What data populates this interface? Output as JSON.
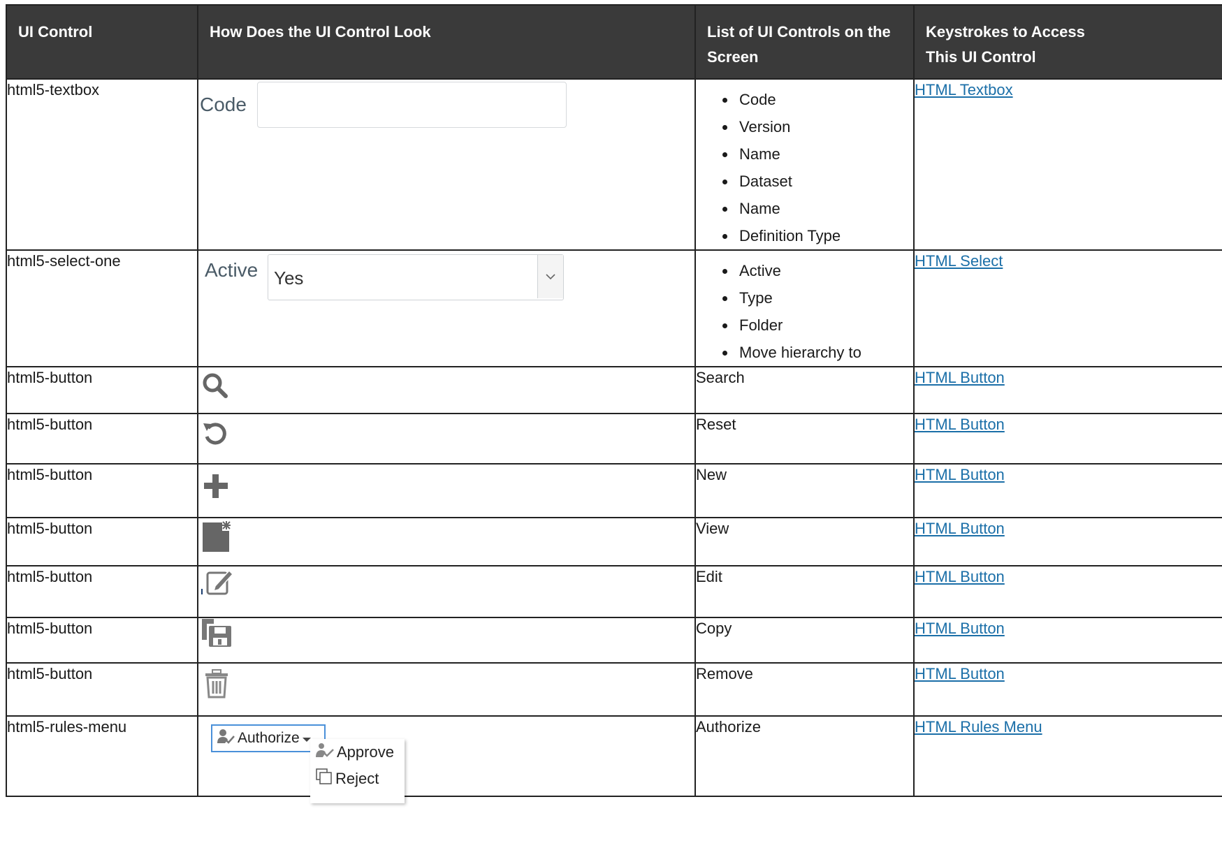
{
  "table": {
    "headers": {
      "ui_control": "UI Control",
      "look": "How Does the UI Control Look",
      "list_line1": "List of UI Controls on the",
      "list_line2": "Screen",
      "keys_line1": "Keystrokes to Access",
      "keys_line2": "This UI Control"
    },
    "rows": [
      {
        "control": "html5-textbox",
        "items": [
          "Code",
          "Version",
          "Name",
          "Dataset",
          "Name",
          "Definition Type"
        ],
        "link": "HTML Textbox"
      },
      {
        "control": "html5-select-one",
        "items": [
          "Active",
          "Type",
          "Folder",
          "Move hierarchy to"
        ],
        "link": "HTML Select"
      },
      {
        "control": "html5-button",
        "list_text": "Search",
        "link": "HTML Button"
      },
      {
        "control": "html5-button",
        "list_text": "Reset",
        "link": "HTML Button"
      },
      {
        "control": "html5-button",
        "list_text": "New",
        "link": "HTML Button"
      },
      {
        "control": "html5-button",
        "list_text": "View",
        "link": "HTML Button"
      },
      {
        "control": "html5-button",
        "list_text": "Edit",
        "link": "HTML Button"
      },
      {
        "control": "html5-button",
        "list_text": "Copy",
        "link": "HTML Button"
      },
      {
        "control": "html5-button",
        "list_text": "Remove",
        "link": "HTML Button"
      },
      {
        "control": "html5-rules-menu",
        "list_text": "Authorize",
        "link": "HTML Rules Menu"
      }
    ]
  },
  "samples": {
    "textbox_label": "Code",
    "select_label": "Active",
    "select_value": "Yes",
    "menu_label": "Authorize",
    "menu_items": [
      "Approve",
      "Reject"
    ]
  },
  "icons": [
    "search-icon",
    "reset-icon",
    "add-icon",
    "view-icon",
    "edit-icon",
    "copy-icon",
    "delete-icon",
    "authorize-icon",
    "approve-icon",
    "reject-icon",
    "chevron-down-icon"
  ],
  "colors": {
    "header_bg": "#3a3a3a",
    "link": "#1b6fa8",
    "icon_gray": "#666666"
  }
}
